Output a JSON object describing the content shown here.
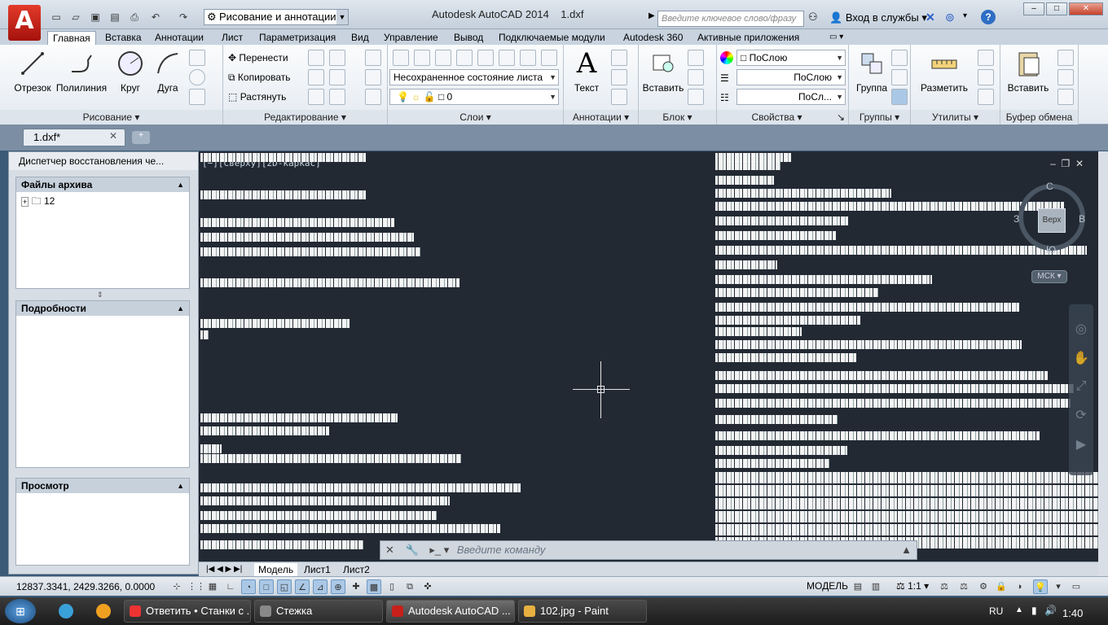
{
  "title_bar": {
    "app_logo": "A",
    "workspace": "Рисование и аннотации",
    "window_title": "Autodesk AutoCAD 2014",
    "file_name": "1.dxf",
    "search_placeholder": "Введите ключевое слово/фразу",
    "signin": "Вход в службы"
  },
  "ribbon_tabs": [
    "Главная",
    "Вставка",
    "Аннотации",
    "Лист",
    "Параметризация",
    "Вид",
    "Управление",
    "Вывод",
    "Подключаемые модули",
    "Autodesk 360",
    "Активные приложения"
  ],
  "panels": {
    "draw": {
      "title": "Рисование",
      "line": "Отрезок",
      "polyline": "Полилиния",
      "circle": "Круг",
      "arc": "Дуга"
    },
    "modify": {
      "title": "Редактирование",
      "move": "Перенести",
      "copy": "Копировать",
      "stretch": "Растянуть"
    },
    "layers": {
      "title": "Слои",
      "state": "Несохраненное состояние листа",
      "layer": "0"
    },
    "annotation": {
      "title": "Аннотации",
      "text": "Текст"
    },
    "block": {
      "title": "Блок",
      "insert": "Вставить"
    },
    "properties": {
      "title": "Свойства",
      "color": "ПоСлою",
      "linetype": "ПоСлою",
      "lineweight": "ПоСл..."
    },
    "groups": {
      "title": "Группы",
      "group": "Группа"
    },
    "utilities": {
      "title": "Утилиты",
      "measure": "Разметить"
    },
    "clipboard": {
      "title": "Буфер обмена",
      "paste": "Вставить"
    }
  },
  "file_tab": "1.dxf*",
  "palette": {
    "title": "Диспетчер восстановления че...",
    "archive": "Файлы архива",
    "tree_item": "12",
    "details": "Подробности",
    "preview": "Просмотр"
  },
  "viewport": {
    "label": "[−][Сверху][2D-каркас]",
    "compass": {
      "n": "С",
      "s": "Ю",
      "w": "З",
      "e": "В",
      "face": "Верх"
    },
    "ucs": "МСК",
    "command_placeholder": "Введите команду"
  },
  "layout_tabs": [
    "Модель",
    "Лист1",
    "Лист2"
  ],
  "status": {
    "coords": "12837.3341, 2429.3266, 0.0000",
    "space": "МОДЕЛЬ",
    "scale": "1:1"
  },
  "taskbar": {
    "items": [
      "Ответить • Станки с ...",
      "Стежка",
      "Autodesk AutoCAD ...",
      "102.jpg - Paint"
    ],
    "lang": "RU",
    "time": "1:40"
  }
}
